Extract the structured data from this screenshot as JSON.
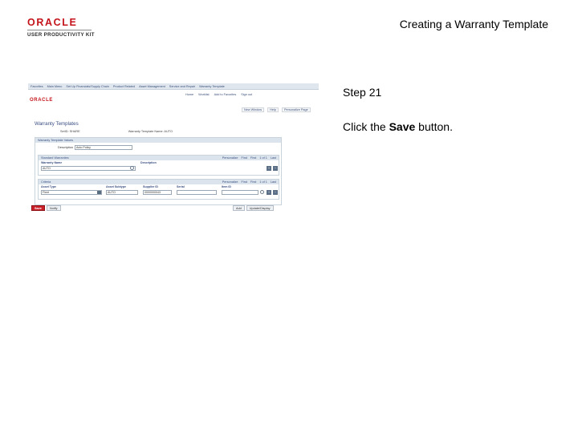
{
  "slide": {
    "logo_word": "ORACLE",
    "logo_sub": "USER PRODUCTIVITY KIT",
    "title": "Creating a Warranty Template",
    "step": "Step 21",
    "instruction_prefix": "Click the ",
    "instruction_target": "Save",
    "instruction_suffix": " button."
  },
  "screenshot": {
    "breadcrumbs": [
      "Favorites",
      "Main Menu",
      "Set Up Financials/Supply Chain",
      "Product Related",
      "Asset Management",
      "Service and Repair",
      "Warranty Template"
    ],
    "top_links": [
      "Home",
      "Worklist",
      "Add to Favorites",
      "Sign out"
    ],
    "brand": "ORACLE",
    "window_links": [
      "New Window",
      "Help",
      "Personalize Page"
    ],
    "page_heading": "Warranty Templates",
    "setid": "SetID: SHARE",
    "warranty_template": "Warranty Template Name: AUTO",
    "section_title": "Warranty Template Values",
    "description_label": "Description",
    "description_value": "Auto Policy",
    "grid1": {
      "title": "Standard Warranties",
      "nav": [
        "Personalize",
        "Find",
        "First",
        "1 of 1",
        "Last"
      ],
      "col_warranty": "Warranty Name",
      "col_description": "Description",
      "value": "AUTO"
    },
    "grid2": {
      "title": "Criteria",
      "nav": [
        "Personalize",
        "Find",
        "First",
        "1 of 1",
        "Last"
      ],
      "col_asset_type": "Asset Type",
      "col_subtype": "Asset Subtype",
      "col_supplier": "Supplier ID",
      "col_serial": "Serial",
      "col_item": "Item ID",
      "asset_type_value": "Fleet",
      "subtype_value": "AUTO",
      "supplier_value": "0000000043"
    },
    "buttons": {
      "save": "Save",
      "notify": "Notify",
      "add": "Add",
      "update": "Update/Display"
    }
  }
}
